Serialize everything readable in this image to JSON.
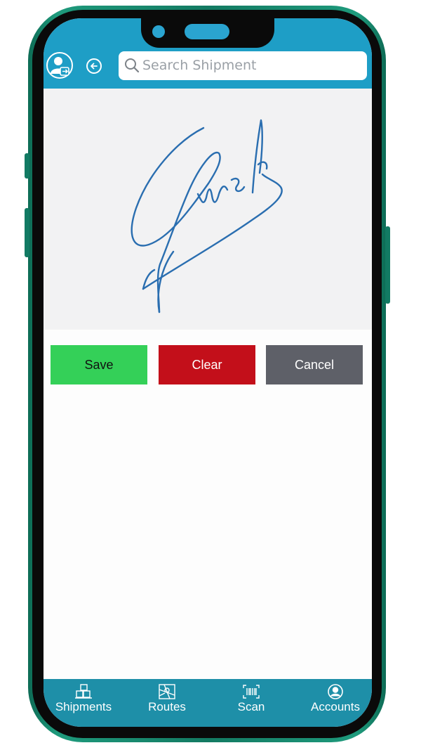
{
  "header": {
    "avatar_icon": "user-logout-icon",
    "back_icon": "arrow-left-icon",
    "search_placeholder": "Search Shipment",
    "search_icon": "search-icon",
    "background": "#1e9ec6"
  },
  "signature": {
    "ink_color": "#2a6eb0",
    "pad_background": "#f2f2f3"
  },
  "actions": {
    "save_label": "Save",
    "clear_label": "Clear",
    "cancel_label": "Cancel",
    "save_color": "#34d058",
    "clear_color": "#c30f1a",
    "cancel_color": "#5e6068"
  },
  "nav": {
    "items": [
      {
        "label": "Shipments",
        "icon": "boxes-icon"
      },
      {
        "label": "Routes",
        "icon": "map-icon"
      },
      {
        "label": "Scan",
        "icon": "barcode-icon"
      },
      {
        "label": "Accounts",
        "icon": "user-circle-icon"
      }
    ],
    "background": "#1e8fa8"
  }
}
